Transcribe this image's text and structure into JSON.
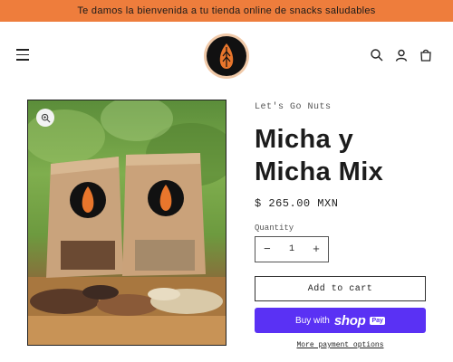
{
  "announcement": {
    "text": "Te damos la bienvenida a tu tienda online de snacks saludables"
  },
  "header": {
    "menu_icon": "hamburger-menu-icon",
    "logo_icon": "almond-logo-icon",
    "icons": [
      "search-icon",
      "account-icon",
      "cart-icon"
    ]
  },
  "product": {
    "vendor": "Let's Go Nuts",
    "title": "Micha y Micha Mix",
    "price": "$ 265.00 MXN",
    "quantity_label": "Quantity",
    "quantity_value": "1",
    "decrease": "−",
    "increase": "+",
    "add_to_cart": "Add to cart",
    "buy_with": "Buy with",
    "shop_word": "shop",
    "pay_word": "Pay",
    "more_options": "More payment options"
  },
  "colors": {
    "announcement_bg": "#ee7d3c",
    "shop_pay_bg": "#5a31f4",
    "logo_ring": "#f0c9a8",
    "almond": "#e8762c"
  }
}
